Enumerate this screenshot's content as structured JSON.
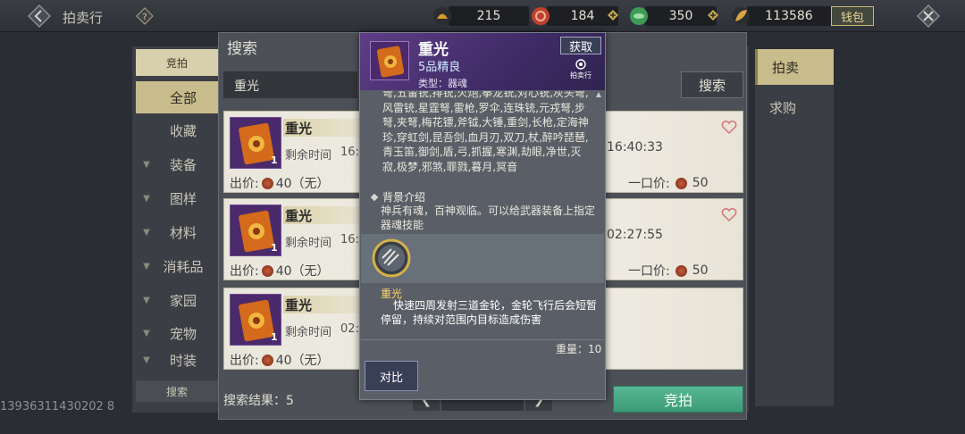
{
  "topbar": {
    "title": "拍卖行",
    "resources": [
      {
        "icon": "gold-ingot-icon",
        "value": "215",
        "color": "#d49a2b"
      },
      {
        "icon": "red-coin-icon",
        "value": "184",
        "color": "#c0422e"
      },
      {
        "icon": "jade-icon",
        "value": "350",
        "color": "#3e9a55"
      },
      {
        "icon": "gold-leaf-icon",
        "value": "113586",
        "color": "#d9a441"
      }
    ],
    "wallet_label": "钱包"
  },
  "left_nav": {
    "top_tab": "竞拍",
    "items": [
      "全部",
      "收藏",
      "装备",
      "图样",
      "材料",
      "消耗品",
      "家园",
      "宠物",
      "时装"
    ],
    "search_label": "搜索"
  },
  "right_tabs": [
    "拍卖",
    "求购"
  ],
  "player_id": "13936311430202 8",
  "dialog": {
    "title": "搜索",
    "search_value": "重光",
    "search_button": "搜索",
    "results_label": "搜索结果：5",
    "auction_button": "竞拍"
  },
  "listings": [
    {
      "name": "重光",
      "qty": "1",
      "remain_label": "剩余时间",
      "remain_value": "16:4",
      "bid_label": "出价:",
      "bid_value": "40（无）",
      "end_time": "16:40:33",
      "buyout_label": "一口价:",
      "buyout_value": "50"
    },
    {
      "name": "重光",
      "qty": "1",
      "remain_label": "剩余时间",
      "remain_value": "16:4",
      "bid_label": "出价:",
      "bid_value": "40（无）",
      "end_time": "02:27:55",
      "buyout_label": "一口价:",
      "buyout_value": "50"
    },
    {
      "name": "重光",
      "qty": "1",
      "remain_label": "剩余时间",
      "remain_value": "02:2",
      "bid_label": "出价:",
      "bid_value": "40（无）"
    }
  ],
  "tooltip": {
    "name": "重光",
    "grade": "5品精良",
    "type": "类型：器魂",
    "get_button": "获取",
    "auction_house_label": "拍卖行",
    "weapons_text": "弩,五雷铳,排铳,火炮,拳龙铳,对心铳,灰头弩,风雷铳,星霆弩,雷枪,罗伞,连珠铳,元戎弩,步弩,夹弩,梅花镖,斧钺,大锤,重剑,长枪,定海神珍,穿虹剑,昆吾剑,血月刃,双刀,杖,醉吟琵琶,青玉笛,御剑,盾,弓,抓握,寒渊,劫眼,净世,灭寂,极梦,邪煞,罪戮,暮月,冥音",
    "background_title": "背景介绍",
    "background_text": "神兵有魂，百神观临。可以给武器装备上指定器魂技能",
    "skill_name": "重光",
    "skill_desc": "快速四周发射三道金轮，金轮飞行后会短暂停留，持续对范围内目标造成伤害",
    "weight": "重量：10",
    "compare_button": "对比"
  }
}
